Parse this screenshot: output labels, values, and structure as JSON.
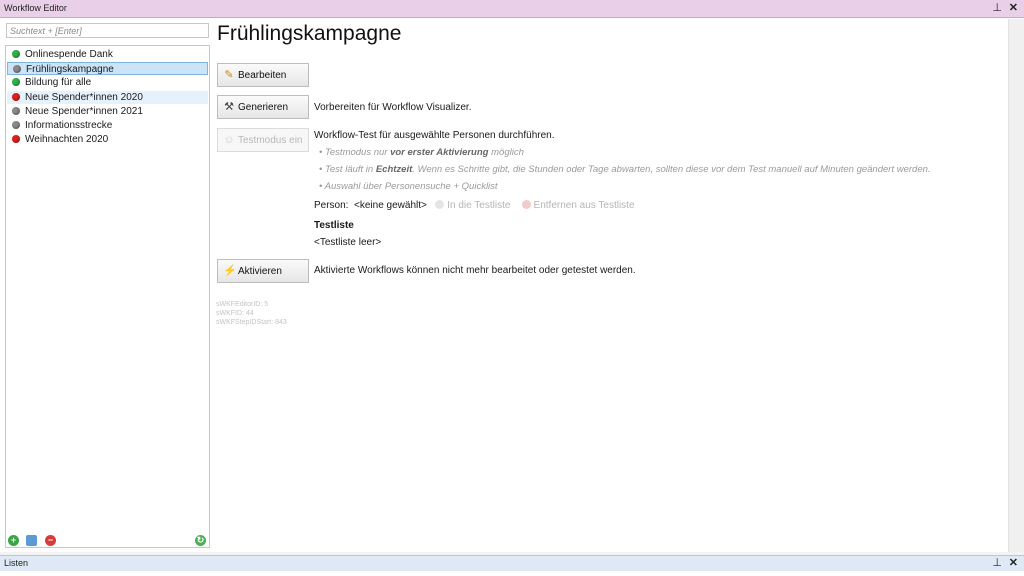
{
  "window": {
    "title": "Workflow Editor",
    "pin_icon": "pin-icon",
    "close_icon": "close-icon",
    "pin_glyph": "⊥",
    "close_glyph": "✕"
  },
  "search": {
    "placeholder": "Suchtext + [Enter]"
  },
  "workflows": [
    {
      "label": "Onlinespende Dank",
      "status_color": "#2db34a",
      "selected": false,
      "hover": false
    },
    {
      "label": "Frühlingskampagne",
      "status_color": "#8a8a8a",
      "selected": true,
      "hover": false
    },
    {
      "label": "Bildung für alle",
      "status_color": "#2db34a",
      "selected": false,
      "hover": false
    },
    {
      "label": "Neue Spender*innen 2020",
      "status_color": "#e02020",
      "selected": false,
      "hover": true
    },
    {
      "label": "Neue Spender*innen 2021",
      "status_color": "#8a8a8a",
      "selected": false,
      "hover": false
    },
    {
      "label": "Informationsstrecke",
      "status_color": "#8a8a8a",
      "selected": false,
      "hover": false
    },
    {
      "label": "Weihnachten 2020",
      "status_color": "#e02020",
      "selected": false,
      "hover": false
    }
  ],
  "list_toolbar": {
    "add_icon": "add-icon",
    "copy_icon": "copy-icon",
    "delete_icon": "delete-icon",
    "refresh_icon": "refresh-icon"
  },
  "detail": {
    "title": "Frühlingskampagne",
    "edit_button": "Bearbeiten",
    "generate_button": "Generieren",
    "generate_desc": "Vorbereiten für Workflow Visualizer.",
    "testmode_button": "Testmodus ein",
    "testmode_desc": "Workflow-Test für ausgewählte Personen durchführen.",
    "bullet1_pre": "• Testmodus nur ",
    "bullet1_bold": "vor erster Aktivierung",
    "bullet1_post": " möglich",
    "bullet2_pre": "• Test läuft in ",
    "bullet2_bold": "Echtzeit",
    "bullet2_post": ". Wenn es Schritte gibt, die Stunden oder Tage abwarten, sollten diese vor dem Test manuell auf Minuten geändert werden.",
    "bullet3": "• Auswahl über Personensuche + Quicklist",
    "person_label": "Person:",
    "person_value": "<keine gewählt>",
    "add_to_testlist": "In die Testliste",
    "remove_from_testlist": "Entfernen aus Testliste",
    "testlist_heading": "Testliste",
    "testlist_empty": "<Testliste leer>",
    "activate_button": "Aktivieren",
    "activate_desc": "Aktivierte Workflows können nicht mehr bearbeitet oder getestet werden.",
    "id1": "sWKFEditorID: 5",
    "id2": "sWKFID: 44",
    "id3": "sWKFStepIDStart: 843"
  },
  "bottom_panel": {
    "title": "Listen"
  }
}
